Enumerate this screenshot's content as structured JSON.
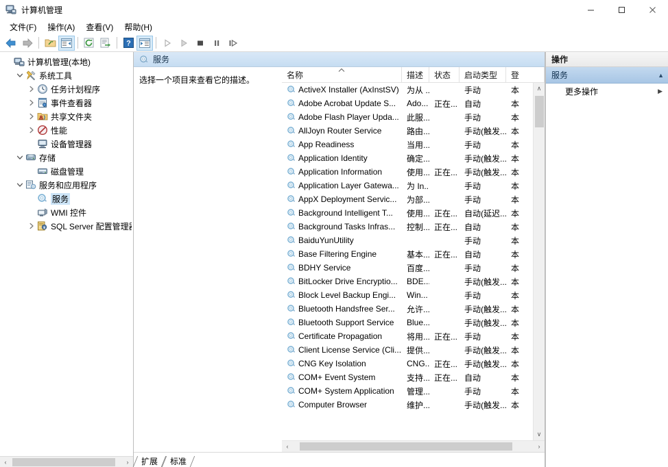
{
  "window": {
    "title": "计算机管理",
    "icon": "computer-management-icon",
    "minimize_label": "—",
    "maximize_label": "□",
    "close_label": "✕"
  },
  "menubar": {
    "items": [
      {
        "label": "文件(F)",
        "name": "menu-file"
      },
      {
        "label": "操作(A)",
        "name": "menu-action"
      },
      {
        "label": "查看(V)",
        "name": "menu-view"
      },
      {
        "label": "帮助(H)",
        "name": "menu-help"
      }
    ]
  },
  "toolbar": {
    "buttons": [
      {
        "name": "back-button",
        "icon": "back-arrow-icon",
        "enabled": true
      },
      {
        "name": "forward-button",
        "icon": "forward-arrow-icon",
        "enabled": false
      },
      {
        "name": "up-folder-button",
        "icon": "up-folder-icon",
        "enabled": true
      },
      {
        "name": "show-hide-tree-button",
        "icon": "show-console-tree-icon",
        "enabled": true
      },
      {
        "name": "refresh-button",
        "icon": "refresh-icon",
        "enabled": true
      },
      {
        "name": "export-list-button",
        "icon": "export-list-icon",
        "enabled": true
      },
      {
        "name": "help-button",
        "icon": "help-question-icon",
        "enabled": true
      },
      {
        "name": "show-action-pane-button",
        "icon": "show-action-pane-icon",
        "enabled": true
      },
      {
        "name": "start-service-button",
        "icon": "play-icon",
        "enabled": false
      },
      {
        "name": "resume-service-button",
        "icon": "play-outline-icon",
        "enabled": false
      },
      {
        "name": "stop-service-button",
        "icon": "stop-square-icon",
        "enabled": true
      },
      {
        "name": "pause-service-button",
        "icon": "pause-bars-icon",
        "enabled": true
      },
      {
        "name": "restart-service-button",
        "icon": "restart-icon",
        "enabled": true
      }
    ]
  },
  "tree": {
    "nodes": [
      {
        "label": "计算机管理(本地)",
        "indent": 0,
        "twisty": "",
        "icon": "computer-icon",
        "selected": false
      },
      {
        "label": "系统工具",
        "indent": 1,
        "twisty": "expanded",
        "icon": "system-tools-icon",
        "selected": false
      },
      {
        "label": "任务计划程序",
        "indent": 2,
        "twisty": "collapsed",
        "icon": "task-scheduler-icon",
        "selected": false
      },
      {
        "label": "事件查看器",
        "indent": 2,
        "twisty": "collapsed",
        "icon": "event-viewer-icon",
        "selected": false
      },
      {
        "label": "共享文件夹",
        "indent": 2,
        "twisty": "collapsed",
        "icon": "shared-folders-icon",
        "selected": false
      },
      {
        "label": "性能",
        "indent": 2,
        "twisty": "collapsed",
        "icon": "performance-icon",
        "selected": false
      },
      {
        "label": "设备管理器",
        "indent": 2,
        "twisty": "",
        "icon": "device-manager-icon",
        "selected": false
      },
      {
        "label": "存储",
        "indent": 1,
        "twisty": "expanded",
        "icon": "storage-icon",
        "selected": false
      },
      {
        "label": "磁盘管理",
        "indent": 2,
        "twisty": "",
        "icon": "disk-management-icon",
        "selected": false
      },
      {
        "label": "服务和应用程序",
        "indent": 1,
        "twisty": "expanded",
        "icon": "services-and-applications-icon",
        "selected": false
      },
      {
        "label": "服务",
        "indent": 2,
        "twisty": "",
        "icon": "services-icon",
        "selected": true
      },
      {
        "label": "WMI 控件",
        "indent": 2,
        "twisty": "",
        "icon": "wmi-control-icon",
        "selected": false
      },
      {
        "label": "SQL Server 配置管理器",
        "indent": 2,
        "twisty": "collapsed",
        "icon": "sql-server-config-icon",
        "selected": false
      }
    ]
  },
  "center": {
    "header_title": "服务",
    "header_icon": "services-icon",
    "description_placeholder": "选择一个项目来查看它的描述。"
  },
  "list": {
    "columns": [
      {
        "key": "name",
        "label": "名称",
        "sorted": "asc"
      },
      {
        "key": "desc",
        "label": "描述",
        "sorted": ""
      },
      {
        "key": "state",
        "label": "状态",
        "sorted": ""
      },
      {
        "key": "start",
        "label": "启动类型",
        "sorted": ""
      },
      {
        "key": "logon",
        "label": "登",
        "sorted": ""
      }
    ],
    "rows": [
      {
        "name": "ActiveX Installer (AxInstSV)",
        "desc": "为从 ...",
        "state": "",
        "start": "手动",
        "logon": "本"
      },
      {
        "name": "Adobe Acrobat Update S...",
        "desc": "Ado...",
        "state": "正在...",
        "start": "自动",
        "logon": "本"
      },
      {
        "name": "Adobe Flash Player Upda...",
        "desc": "此服...",
        "state": "",
        "start": "手动",
        "logon": "本"
      },
      {
        "name": "AllJoyn Router Service",
        "desc": "路由...",
        "state": "",
        "start": "手动(触发...",
        "logon": "本"
      },
      {
        "name": "App Readiness",
        "desc": "当用...",
        "state": "",
        "start": "手动",
        "logon": "本"
      },
      {
        "name": "Application Identity",
        "desc": "确定...",
        "state": "",
        "start": "手动(触发...",
        "logon": "本"
      },
      {
        "name": "Application Information",
        "desc": "使用...",
        "state": "正在...",
        "start": "手动(触发...",
        "logon": "本"
      },
      {
        "name": "Application Layer Gatewa...",
        "desc": "为 In...",
        "state": "",
        "start": "手动",
        "logon": "本"
      },
      {
        "name": "AppX Deployment Servic...",
        "desc": "为部...",
        "state": "",
        "start": "手动",
        "logon": "本"
      },
      {
        "name": "Background Intelligent T...",
        "desc": "使用...",
        "state": "正在...",
        "start": "自动(延迟...",
        "logon": "本"
      },
      {
        "name": "Background Tasks Infras...",
        "desc": "控制...",
        "state": "正在...",
        "start": "自动",
        "logon": "本"
      },
      {
        "name": "BaiduYunUtility",
        "desc": "",
        "state": "",
        "start": "手动",
        "logon": "本"
      },
      {
        "name": "Base Filtering Engine",
        "desc": "基本...",
        "state": "正在...",
        "start": "自动",
        "logon": "本"
      },
      {
        "name": "BDHY Service",
        "desc": "百度...",
        "state": "",
        "start": "手动",
        "logon": "本"
      },
      {
        "name": "BitLocker Drive Encryptio...",
        "desc": "BDE...",
        "state": "",
        "start": "手动(触发...",
        "logon": "本"
      },
      {
        "name": "Block Level Backup Engi...",
        "desc": "Win...",
        "state": "",
        "start": "手动",
        "logon": "本"
      },
      {
        "name": "Bluetooth Handsfree Ser...",
        "desc": "允许...",
        "state": "",
        "start": "手动(触发...",
        "logon": "本"
      },
      {
        "name": "Bluetooth Support Service",
        "desc": "Blue...",
        "state": "",
        "start": "手动(触发...",
        "logon": "本"
      },
      {
        "name": "Certificate Propagation",
        "desc": "将用...",
        "state": "正在...",
        "start": "手动",
        "logon": "本"
      },
      {
        "name": "Client License Service (Cli...",
        "desc": "提供...",
        "state": "",
        "start": "手动(触发...",
        "logon": "本"
      },
      {
        "name": "CNG Key Isolation",
        "desc": "CNG...",
        "state": "正在...",
        "start": "手动(触发...",
        "logon": "本"
      },
      {
        "name": "COM+ Event System",
        "desc": "支持...",
        "state": "正在...",
        "start": "自动",
        "logon": "本"
      },
      {
        "name": "COM+ System Application",
        "desc": "管理...",
        "state": "",
        "start": "手动",
        "logon": "本"
      },
      {
        "name": "Computer Browser",
        "desc": "维护...",
        "state": "",
        "start": "手动(触发...",
        "logon": "本"
      }
    ]
  },
  "view_tabs": [
    {
      "label": "扩展",
      "name": "tab-extended",
      "active": false
    },
    {
      "label": "标准",
      "name": "tab-standard",
      "active": true
    }
  ],
  "actions": {
    "header": "操作",
    "group_label": "服务",
    "collapse_glyph": "▲",
    "items": [
      {
        "label": "更多操作",
        "name": "action-more-actions",
        "submenu_glyph": "▶"
      }
    ]
  },
  "scrollbars": {
    "left_arrow": "‹",
    "right_arrow": "›",
    "up_arrow": "∧",
    "down_arrow": "∨"
  },
  "colors": {
    "selection_blue": "#cce4f7",
    "panel_header_blue": "#c6ddf2",
    "action_group_blue": "#a8c6e5",
    "service_icon_blue": "#7fb3d5"
  }
}
